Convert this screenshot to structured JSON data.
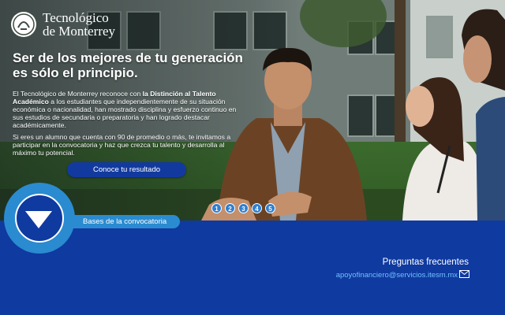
{
  "brand": {
    "line1": "Tecnológico",
    "line2": "de Monterrey"
  },
  "hero": {
    "headline_line1": "Ser de los mejores de tu generación",
    "headline_line2": "es sólo el principio.",
    "para1_a": "El Tecnológico de Monterrey reconoce con ",
    "para1_bold": "la Distinción al Talento Académico",
    "para1_b": " a los estudiantes que independientemente de su situación económica o nacionalidad, han mostrado disciplina y esfuerzo continuo en sus estudios de secundaria o preparatoria y han logrado destacar académicamente.",
    "para2": "Si eres un alumno que cuenta con 90 de promedio o más, te invitamos a participar en la convocatoria y haz que crezca tu talento y desarrolla al máximo tu potencial.",
    "cta_label": "Conoce tu resultado"
  },
  "pager": [
    "1",
    "2",
    "3",
    "4",
    "5"
  ],
  "bases_label": "Bases de la convocatoria",
  "footer": {
    "faq_title": "Preguntas frecuentes",
    "email": "apoyofinanciero@servicios.itesm.mx"
  },
  "colors": {
    "navy": "#0f3aa0",
    "accent": "#2a8bd0",
    "link": "#6fc0ff"
  }
}
